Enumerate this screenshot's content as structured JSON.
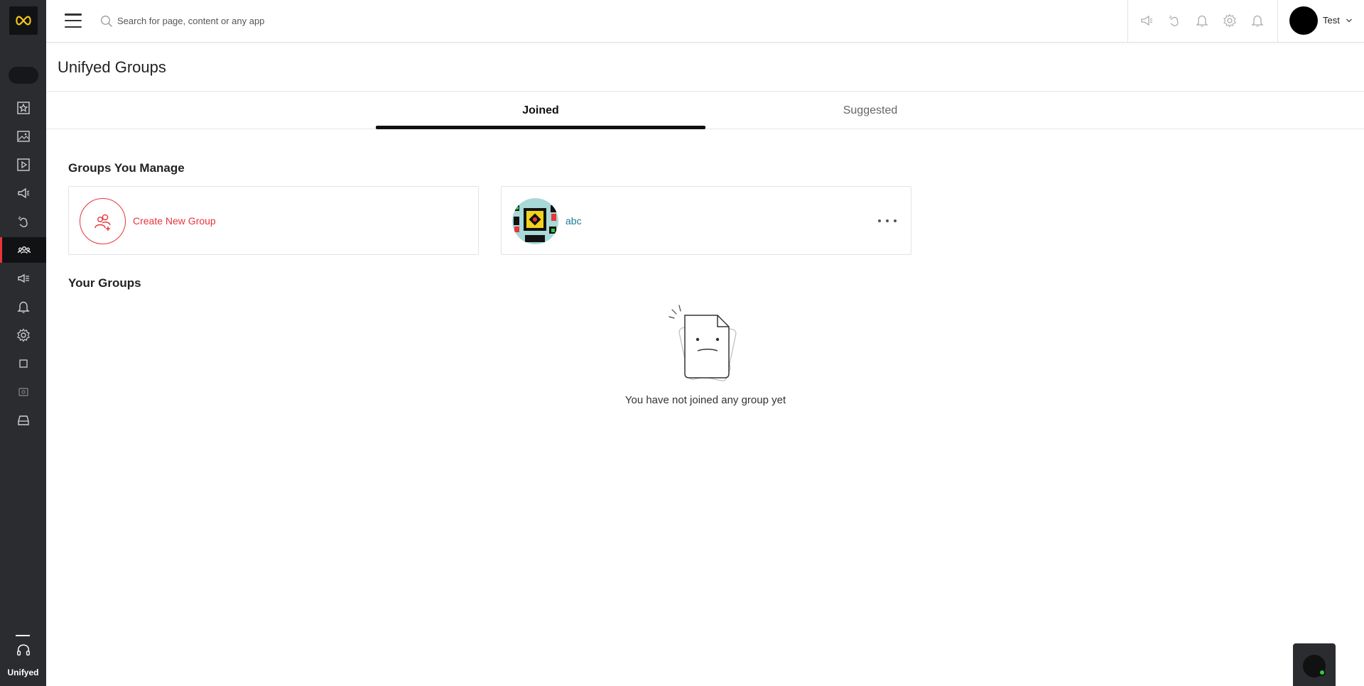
{
  "brand": {
    "name": "Unifyed",
    "accent": "#e8343c"
  },
  "search": {
    "placeholder": "Search for page, content or any app"
  },
  "user": {
    "name": "Test"
  },
  "page": {
    "title": "Unifyed Groups"
  },
  "tabs": [
    {
      "label": "Joined",
      "active": true
    },
    {
      "label": "Suggested",
      "active": false
    }
  ],
  "manage": {
    "title": "Groups You Manage",
    "create_label": "Create New Group",
    "groups": [
      {
        "name": "abc"
      }
    ]
  },
  "your_groups": {
    "title": "Your Groups",
    "empty_message": "You have not joined any group yet"
  },
  "sidebar": {
    "items": [
      {
        "icon": "star-icon"
      },
      {
        "icon": "image-icon"
      },
      {
        "icon": "video-icon"
      },
      {
        "icon": "megaphone-icon"
      },
      {
        "icon": "hand-wave-icon"
      },
      {
        "icon": "groups-icon",
        "active": true
      },
      {
        "icon": "announcement-icon"
      },
      {
        "icon": "bell-icon"
      },
      {
        "icon": "gear-icon"
      },
      {
        "icon": "square-icon"
      },
      {
        "icon": "badge-icon"
      },
      {
        "icon": "inbox-icon"
      }
    ]
  }
}
